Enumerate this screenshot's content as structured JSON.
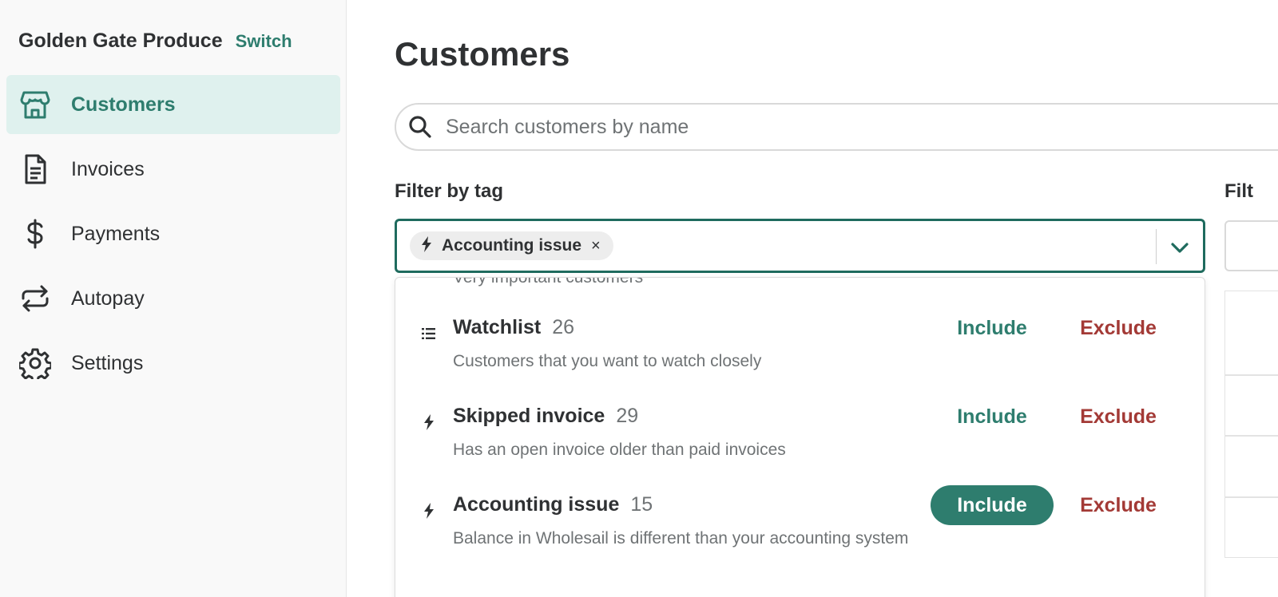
{
  "sidebar": {
    "org_name": "Golden Gate Produce",
    "switch_label": "Switch",
    "items": [
      {
        "label": "Customers",
        "icon": "store-icon",
        "active": true
      },
      {
        "label": "Invoices",
        "icon": "document-icon",
        "active": false
      },
      {
        "label": "Payments",
        "icon": "dollar-icon",
        "active": false
      },
      {
        "label": "Autopay",
        "icon": "repeat-icon",
        "active": false
      },
      {
        "label": "Settings",
        "icon": "gear-icon",
        "active": false
      }
    ]
  },
  "main": {
    "title": "Customers",
    "search": {
      "placeholder": "Search customers by name",
      "value": ""
    },
    "filter_tag": {
      "label": "Filter by tag",
      "selected_chip": {
        "label": "Accounting issue",
        "icon": "bolt-icon",
        "remove": "×"
      }
    },
    "filter_second": {
      "label": "Filt"
    }
  },
  "dropdown": {
    "cut_off_description": "Very important customers",
    "options": [
      {
        "name": "Watchlist",
        "count": "26",
        "description": "Customers that you want to watch closely",
        "icon": "list-icon",
        "include": "Include",
        "exclude": "Exclude",
        "included": false
      },
      {
        "name": "Skipped invoice",
        "count": "29",
        "description": "Has an open invoice older than paid invoices",
        "icon": "bolt-icon",
        "include": "Include",
        "exclude": "Exclude",
        "included": false
      },
      {
        "name": "Accounting issue",
        "count": "15",
        "description": "Balance in Wholesail is different than your accounting system",
        "icon": "bolt-icon",
        "include": "Include",
        "exclude": "Exclude",
        "included": true
      }
    ]
  },
  "colors": {
    "accent": "#2e7d6e",
    "accent_light": "#dff1ee",
    "exclude": "#a33a36",
    "text": "#2f3133",
    "muted": "#6f7375"
  }
}
